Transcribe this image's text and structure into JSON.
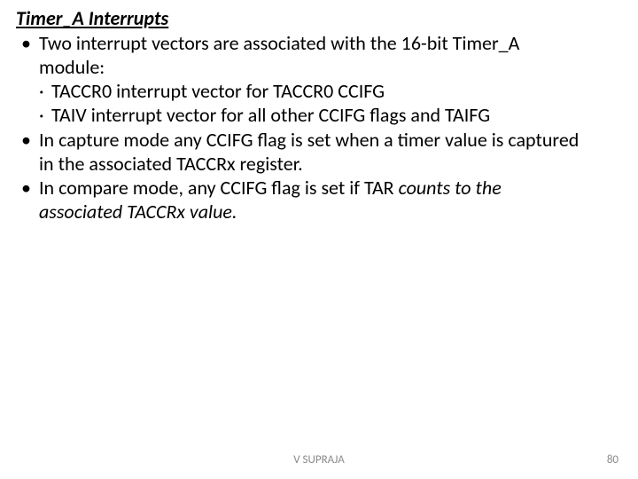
{
  "title": "Timer_A Interrupts",
  "bullets": {
    "b1_line1": "Two interrupt vectors are associated with the 16-bit Timer_A",
    "b1_line2": "module:",
    "b1_sub1": "TACCR0 interrupt vector for TACCR0 CCIFG",
    "b1_sub2": "TAIV interrupt vector for all other CCIFG flags and TAIFG",
    "b2_line1": "In capture mode any CCIFG flag is set when a timer value is captured",
    "b2_line2": "in the associated TACCRx register.",
    "b3_line1": "In compare mode, any CCIFG flag is set if TAR ",
    "b3_italic_line1": "counts to the",
    "b3_italic_line2": "associated TACCRx value."
  },
  "footer": {
    "author": "V SUPRAJA",
    "page": "80"
  }
}
